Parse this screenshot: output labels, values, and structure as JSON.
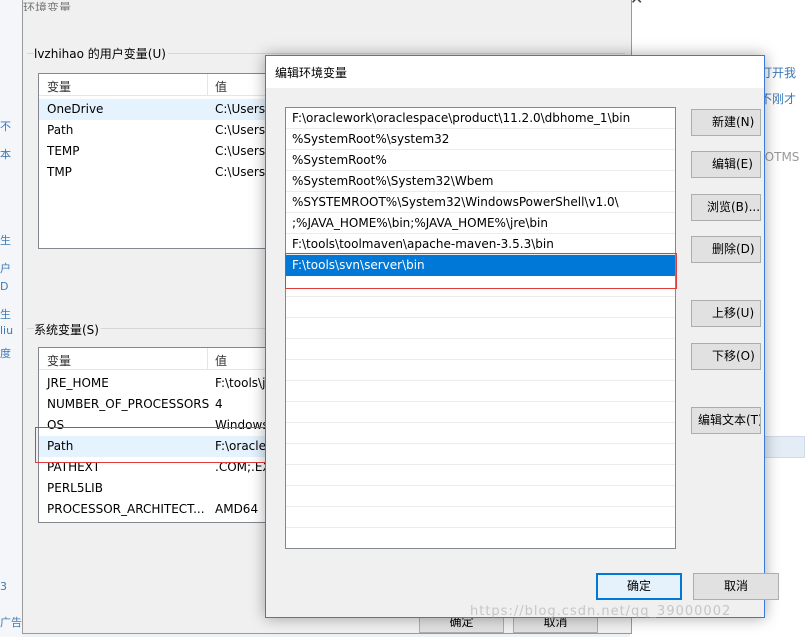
{
  "background": {
    "right_texts": [
      "打开我",
      "不刚才",
      "-OTMS"
    ],
    "left_texts": [
      "不",
      "本",
      "生",
      "户",
      "D",
      "生",
      "liu",
      "度",
      "3",
      "广告"
    ]
  },
  "parent": {
    "title": "环境变量",
    "user_group_label": "lvzhihao 的用户变量(U)",
    "system_group_label": "系统变量(S)",
    "col_var": "变量",
    "col_val": "值",
    "user_vars": [
      {
        "name": "OneDrive",
        "value": "C:\\Users\\"
      },
      {
        "name": "Path",
        "value": "C:\\Users\\"
      },
      {
        "name": "TEMP",
        "value": "C:\\Users\\"
      },
      {
        "name": "TMP",
        "value": "C:\\Users\\"
      }
    ],
    "system_vars": [
      {
        "name": "JRE_HOME",
        "value": "F:\\tools\\j"
      },
      {
        "name": "NUMBER_OF_PROCESSORS",
        "value": "4"
      },
      {
        "name": "OS",
        "value": "Windows"
      },
      {
        "name": "Path",
        "value": "F:\\oracle"
      },
      {
        "name": "PATHEXT",
        "value": ".COM;.EX"
      },
      {
        "name": "PERL5LIB",
        "value": ""
      },
      {
        "name": "PROCESSOR_ARCHITECT...",
        "value": "AMD64"
      }
    ],
    "bottom_ok": "确定",
    "bottom_cancel": "取消"
  },
  "dialog": {
    "title": "编辑环境变量",
    "paths": [
      "F:\\oraclework\\oraclespace\\product\\11.2.0\\dbhome_1\\bin",
      "%SystemRoot%\\system32",
      "%SystemRoot%",
      "%SystemRoot%\\System32\\Wbem",
      "%SYSTEMROOT%\\System32\\WindowsPowerShell\\v1.0\\",
      ";%JAVA_HOME%\\bin;%JAVA_HOME%\\jre\\bin",
      "F:\\tools\\toolmaven\\apache-maven-3.5.3\\bin",
      "F:\\tools\\svn\\server\\bin"
    ],
    "selected_index": 7,
    "buttons": {
      "new": "新建(N)",
      "edit": "编辑(E)",
      "browse": "浏览(B)...",
      "delete": "删除(D)",
      "move_up": "上移(U)",
      "move_down": "下移(O)",
      "edit_text": "编辑文本(T)"
    },
    "ok": "确定",
    "cancel": "取消"
  },
  "watermark": "https://blog.csdn.net/qq_39000002",
  "colors": {
    "selection": "#0078d7",
    "highlight_box": "#e03c3c",
    "dialog_border": "#3b7ad8"
  }
}
